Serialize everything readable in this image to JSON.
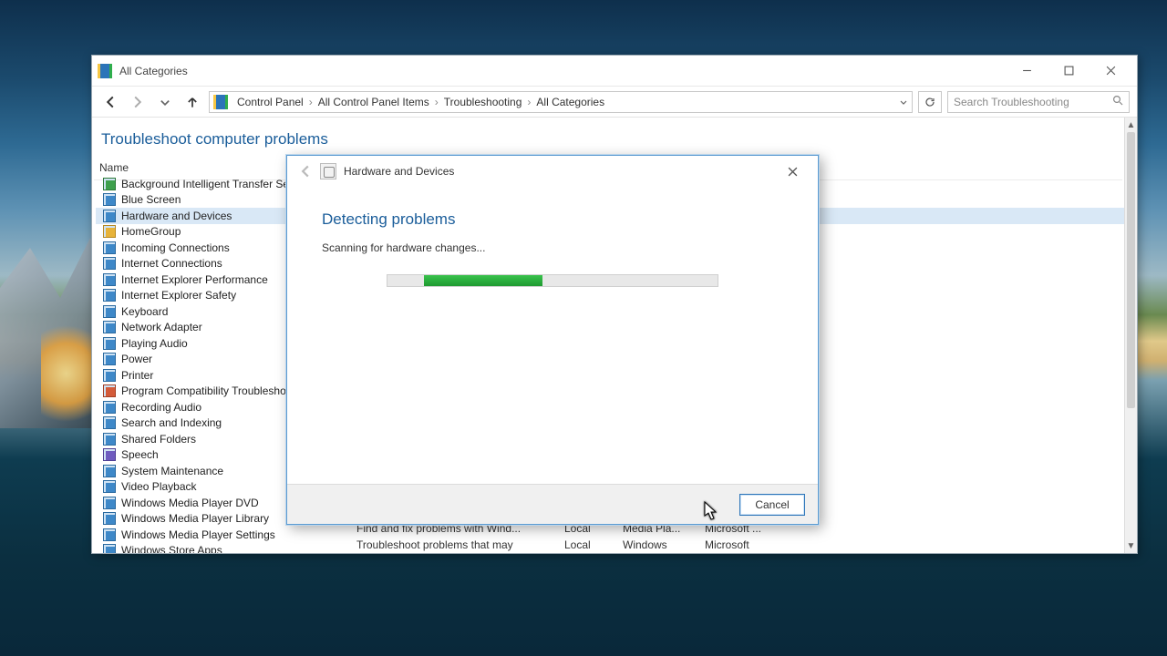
{
  "window": {
    "title": "All Categories",
    "breadcrumb": [
      "Control Panel",
      "All Control Panel Items",
      "Troubleshooting",
      "All Categories"
    ],
    "search_placeholder": "Search Troubleshooting"
  },
  "page": {
    "heading": "Troubleshoot computer problems",
    "column": "Name"
  },
  "list": {
    "selected_index": 2,
    "items": [
      "Background Intelligent Transfer Se",
      "Blue Screen",
      "Hardware and Devices",
      "HomeGroup",
      "Incoming Connections",
      "Internet Connections",
      "Internet Explorer Performance",
      "Internet Explorer Safety",
      "Keyboard",
      "Network Adapter",
      "Playing Audio",
      "Power",
      "Printer",
      "Program Compatibility Troublesho",
      "Recording Audio",
      "Search and Indexing",
      "Shared Folders",
      "Speech",
      "System Maintenance",
      "Video Playback",
      "Windows Media Player DVD",
      "Windows Media Player Library",
      "Windows Media Player Settings",
      "Windows Store Apps"
    ]
  },
  "bottom": {
    "c1": [
      "Find and fix problems with Wind...",
      "Troubleshoot problems that may"
    ],
    "c2": [
      "Local",
      "Local"
    ],
    "c3": [
      "Media Pla...",
      "Windows"
    ],
    "c4": [
      "Microsoft ...",
      "Microsoft"
    ]
  },
  "dialog": {
    "title": "Hardware and Devices",
    "heading": "Detecting problems",
    "message": "Scanning for hardware changes...",
    "cancel": "Cancel"
  }
}
